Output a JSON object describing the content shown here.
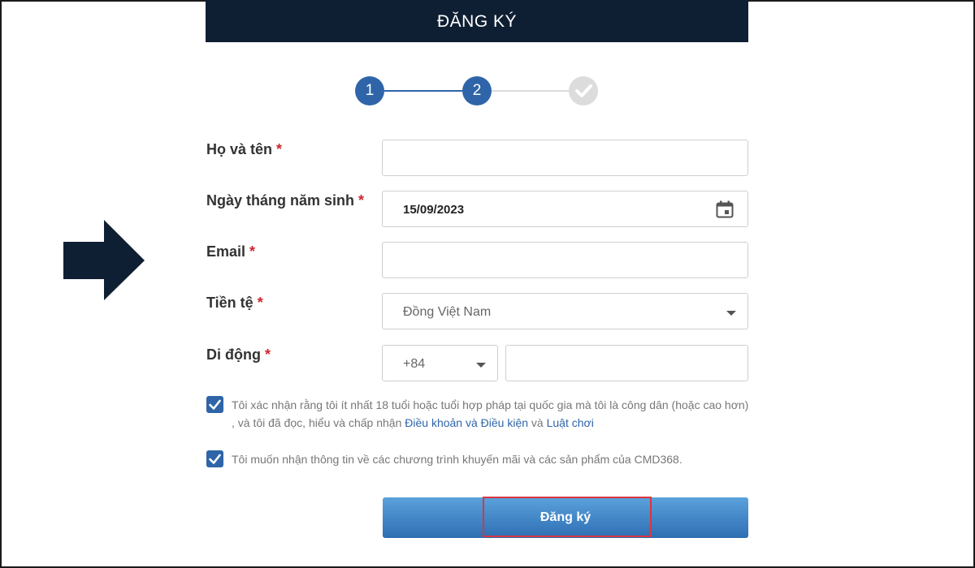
{
  "header": {
    "title": "ĐĂNG KÝ"
  },
  "stepper": {
    "step1": "1",
    "step2": "2",
    "step3_icon": "check-icon"
  },
  "form": {
    "fullname": {
      "label": "Họ và tên",
      "required": "*",
      "value": ""
    },
    "dob": {
      "label": "Ngày tháng năm sinh",
      "required": "*",
      "value": "15/09/2023",
      "icon": "calendar-icon"
    },
    "email": {
      "label": "Email",
      "required": "*",
      "value": ""
    },
    "currency": {
      "label": "Tiền tệ",
      "required": "*",
      "value": "Đồng Việt Nam",
      "icon": "chevron-down-icon"
    },
    "mobile": {
      "label": "Di động",
      "required": "*",
      "country_code": "+84",
      "value": ""
    }
  },
  "consent": {
    "age_text": "Tôi xác nhận rằng tôi ít nhất 18 tuổi hoặc tuổi hợp pháp tại quốc gia mà tôi là công dân (hoặc cao hơn) , và tôi đã đọc, hiểu và chấp nhận ",
    "terms_link": "Điều khoản và Điều kiện",
    "and_text": " và ",
    "rules_link": "Luật chơi",
    "promo_text": "Tôi muốn nhận thông tin về các chương trình khuyến mãi và các sản phẩm của CMD368."
  },
  "submit": {
    "label": "Đăng ký"
  },
  "colors": {
    "header_bg": "#0f1f33",
    "accent": "#2f65a8",
    "required": "#d0262e",
    "highlight": "#d9363e"
  }
}
